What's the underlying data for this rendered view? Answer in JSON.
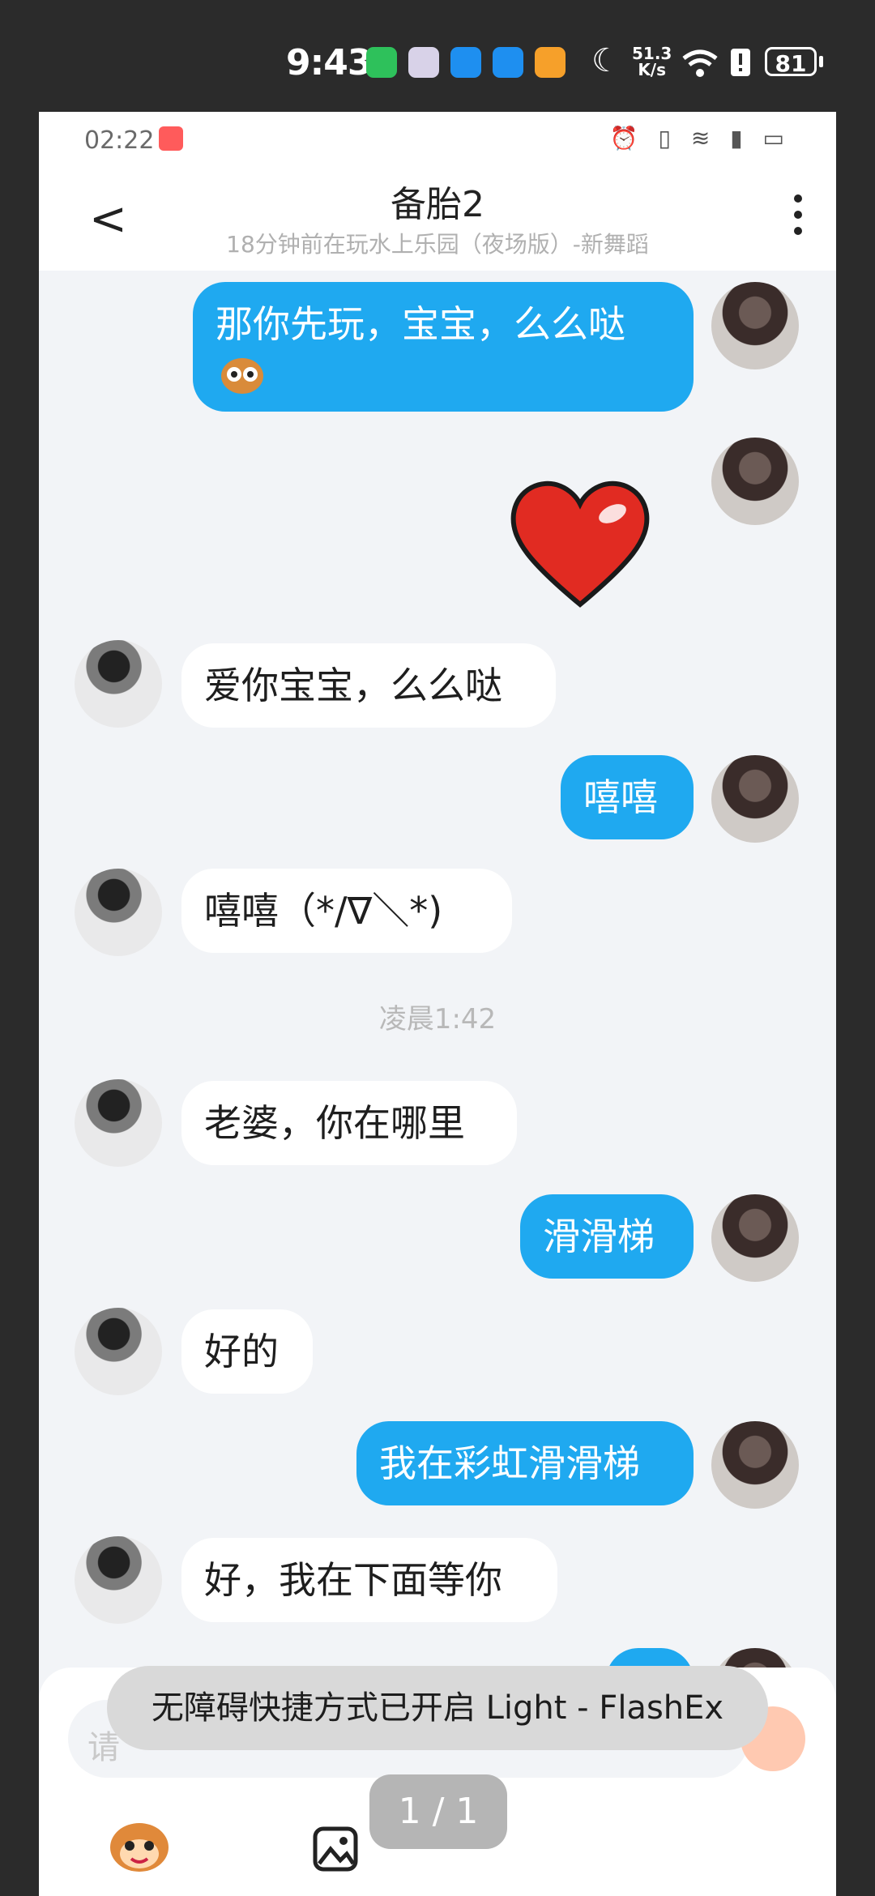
{
  "outer_status": {
    "time": "9:43",
    "speed_value": "51.3",
    "speed_unit": "K/s",
    "battery": "81"
  },
  "inner_status": {
    "time": "02:22"
  },
  "header": {
    "title": "备胎2",
    "subtitle": "18分钟前在玩水上乐园（夜场版）-新舞蹈"
  },
  "messages": [
    {
      "from": "me",
      "text": "那你先玩，宝宝，么么哒"
    },
    {
      "from": "me",
      "text": "",
      "kind": "heart-sticker"
    },
    {
      "from": "them",
      "text": "爱你宝宝，么么哒"
    },
    {
      "from": "me",
      "text": "嘻嘻"
    },
    {
      "from": "them",
      "text": "嘻嘻（*/∇＼*)"
    },
    {
      "from": "them",
      "text": "老婆，你在哪里"
    },
    {
      "from": "me",
      "text": "滑滑梯"
    },
    {
      "from": "them",
      "text": "好的"
    },
    {
      "from": "me",
      "text": "我在彩虹滑滑梯"
    },
    {
      "from": "them",
      "text": "好，我在下面等你"
    }
  ],
  "timestamp": "凌晨1:42",
  "composer": {
    "hint": "请"
  },
  "toast": "无障碍快捷方式已开启 Light - FlashEx",
  "page_indicator": "1 / 1",
  "colors": {
    "bubble_me": "#1fa9f0",
    "bubble_them": "#ffffff",
    "chat_bg": "#f2f4f7"
  }
}
